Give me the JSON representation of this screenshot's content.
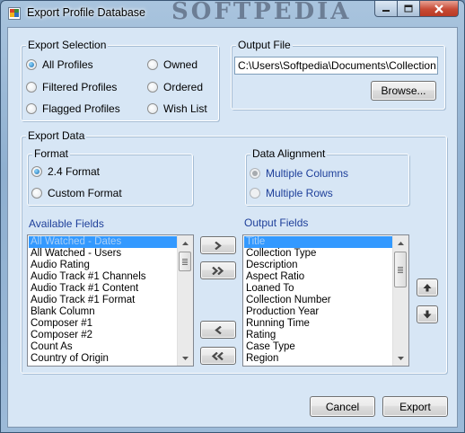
{
  "window": {
    "title": "Export Profile Database",
    "watermark": "SOFTPEDIA"
  },
  "export_selection": {
    "label": "Export Selection",
    "options": [
      "All Profiles",
      "Filtered Profiles",
      "Flagged Profiles",
      "Owned",
      "Ordered",
      "Wish List"
    ],
    "selected": "All Profiles"
  },
  "output_file": {
    "label": "Output File",
    "path": "C:\\Users\\Softpedia\\Documents\\Collection.csv",
    "browse_label": "Browse..."
  },
  "export_data": {
    "label": "Export Data",
    "format": {
      "label": "Format",
      "options": [
        "2.4 Format",
        "Custom Format"
      ],
      "selected": "2.4 Format"
    },
    "alignment": {
      "label": "Data Alignment",
      "options": [
        "Multiple Columns",
        "Multiple Rows"
      ],
      "selected": "Multiple Columns",
      "enabled": false
    }
  },
  "available_fields": {
    "label": "Available Fields",
    "items": [
      "All Watched - Dates",
      "All Watched - Users",
      "Audio Rating",
      "Audio Track #1 Channels",
      "Audio Track #1 Content",
      "Audio Track #1 Format",
      "Blank Column",
      "Composer #1",
      "Composer #2",
      "Count As",
      "Country of Origin"
    ],
    "selected": "All Watched - Dates"
  },
  "output_fields": {
    "label": "Output Fields",
    "items": [
      "Title",
      "Collection Type",
      "Description",
      "Aspect Ratio",
      "Loaned To",
      "Collection Number",
      "Production Year",
      "Running Time",
      "Rating",
      "Case Type",
      "Region"
    ],
    "selected": "Title"
  },
  "transfer_buttons": {
    "add": "add-icon",
    "add_all": "add-all-icon",
    "remove": "remove-icon",
    "remove_all": "remove-all-icon"
  },
  "footer": {
    "cancel_label": "Cancel",
    "export_label": "Export"
  }
}
